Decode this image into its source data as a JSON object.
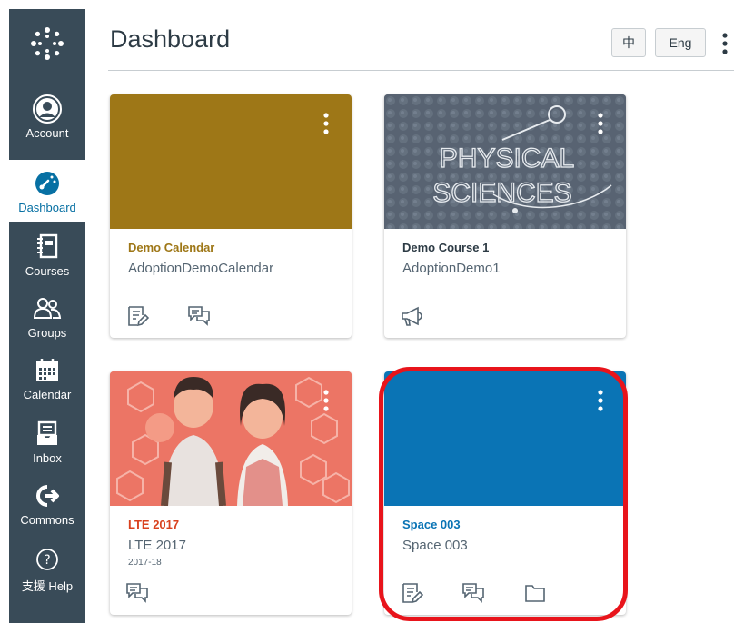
{
  "nav": {
    "items": [
      {
        "label": "Account",
        "icon": "account-icon"
      },
      {
        "label": "Dashboard",
        "icon": "dashboard-icon"
      },
      {
        "label": "Courses",
        "icon": "courses-icon"
      },
      {
        "label": "Groups",
        "icon": "groups-icon"
      },
      {
        "label": "Calendar",
        "icon": "calendar-icon"
      },
      {
        "label": "Inbox",
        "icon": "inbox-icon"
      },
      {
        "label": "Commons",
        "icon": "commons-icon"
      },
      {
        "label": "支援 Help",
        "icon": "help-icon"
      }
    ],
    "active": "Dashboard",
    "bg_color": "#394b58",
    "active_color": "#0770a3"
  },
  "header": {
    "title": "Dashboard",
    "lang_zh": "中",
    "lang_en": "Eng"
  },
  "cards": [
    {
      "title": "Demo Calendar",
      "code": "AdoptionDemoCalendar",
      "term": "",
      "color": "#9e7717",
      "title_color": "#9e7717",
      "icons": [
        "assignments-icon",
        "discussions-icon"
      ]
    },
    {
      "title": "Demo Course 1",
      "code": "AdoptionDemo1",
      "term": "",
      "color": "#5d6a7a",
      "title_color": "#2d3b45",
      "hero_text_1": "PHYSICAL",
      "hero_text_2": "SCIENCES",
      "icons": [
        "announcements-icon"
      ]
    },
    {
      "title": "LTE 2017",
      "code": "LTE 2017",
      "term": "2017-18",
      "color": "#ec6b5c",
      "title_color": "#d9411e",
      "icons": [
        "discussions-icon"
      ]
    },
    {
      "title": "Space 003",
      "code": "Space 003",
      "term": "",
      "color": "#0a74b5",
      "title_color": "#0a74b5",
      "icons": [
        "assignments-icon",
        "discussions-icon",
        "files-icon"
      ]
    }
  ],
  "highlight_color": "#e8141b"
}
